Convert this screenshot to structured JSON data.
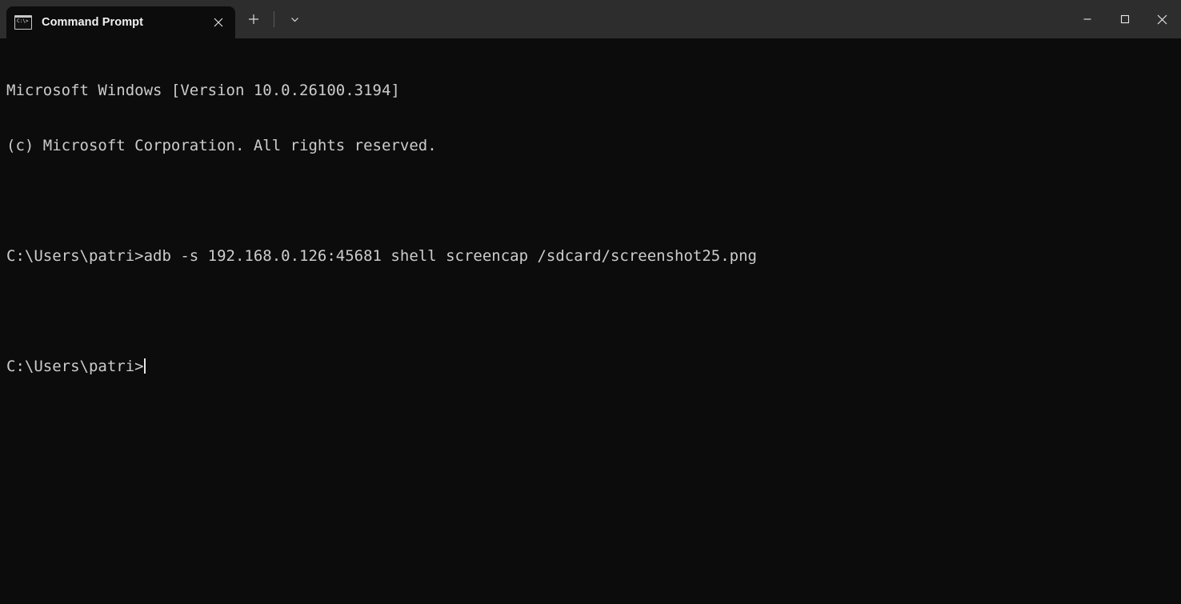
{
  "window": {
    "title": "Command Prompt",
    "background_color": "#0c0c0c",
    "titlebar_color": "#2d2d2d",
    "foreground_color": "#cccccc"
  },
  "titlebar": {
    "tab": {
      "label": "Command Prompt",
      "icon": "console-icon",
      "icon_glyph": "C:\\>",
      "close_label": "✕"
    },
    "new_tab_label": "+",
    "dropdown_label": "⌄",
    "controls": {
      "minimize_label": "─",
      "maximize_label": "□",
      "close_label": "✕"
    }
  },
  "terminal": {
    "lines": [
      "Microsoft Windows [Version 10.0.26100.3194]",
      "(c) Microsoft Corporation. All rights reserved.",
      "",
      "C:\\Users\\patri>adb -s 192.168.0.126:45681 shell screencap /sdcard/screenshot25.png",
      "",
      ""
    ],
    "prompt": "C:\\Users\\patri>",
    "cursor_visible": true
  }
}
